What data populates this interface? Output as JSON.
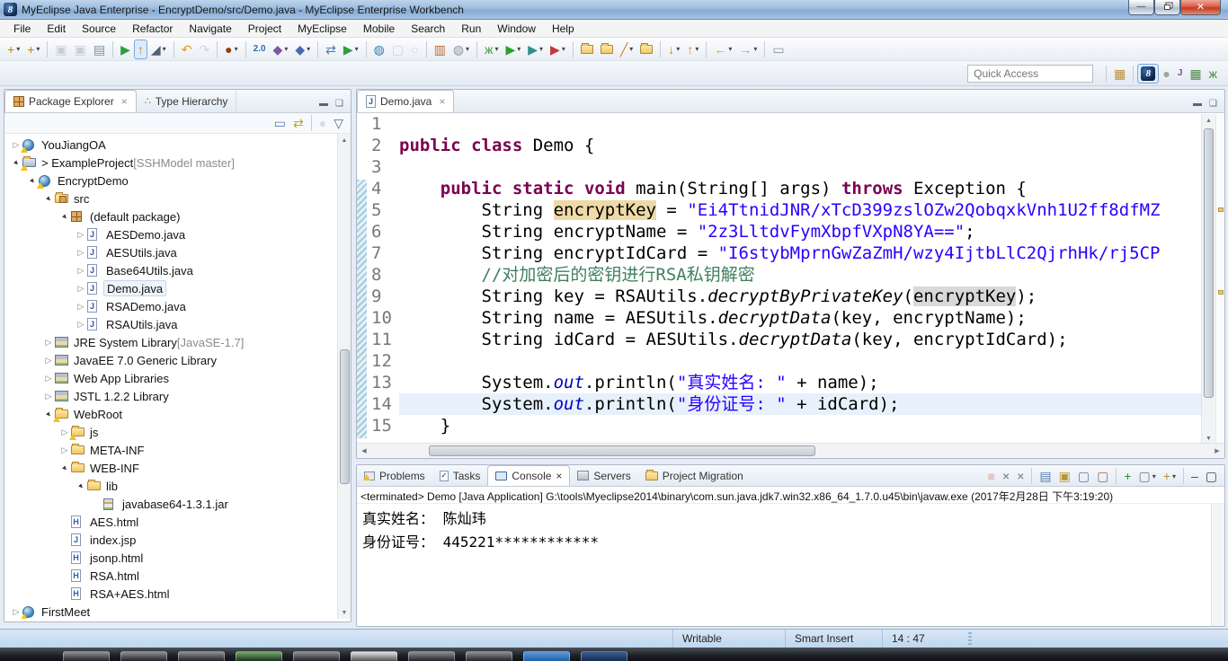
{
  "window": {
    "title": "MyEclipse Java Enterprise - EncryptDemo/src/Demo.java - MyEclipse Enterprise Workbench",
    "controls": {
      "minimize": "minimize",
      "restore": "restore",
      "close": "close"
    }
  },
  "menu_bar": [
    "File",
    "Edit",
    "Source",
    "Refactor",
    "Navigate",
    "Project",
    "MyEclipse",
    "Mobile",
    "Search",
    "Run",
    "Window",
    "Help"
  ],
  "toolbar": {
    "quick_access": "Quick Access",
    "row1": [
      {
        "n": "new-wizard-button",
        "g": "+",
        "c": "#b8860b",
        "dd": 1
      },
      {
        "n": "new-web-project-button",
        "g": "+",
        "c": "#b8860b",
        "dd": 1
      },
      "|",
      {
        "n": "save-button",
        "g": "▣",
        "c": "#8a94a0",
        "dis": 1
      },
      {
        "n": "save-all-button",
        "g": "▣",
        "c": "#8a94a0",
        "dis": 1
      },
      {
        "n": "print-button",
        "g": "▤",
        "c": "#7d8ea4"
      },
      "|",
      {
        "n": "run-mobile-tools-button",
        "g": "▶",
        "c": "#2e9e3e"
      },
      {
        "n": "deploy-project-button",
        "g": "↑",
        "c": "#c08030",
        "sel": 1
      },
      {
        "n": "build-hammer-button",
        "g": "◢",
        "c": "#55606e",
        "dd": 1
      },
      "|",
      {
        "n": "undo-button",
        "g": "↶",
        "c": "#d4a017"
      },
      {
        "n": "redo-button",
        "g": "↷",
        "c": "#9aa4b0",
        "dis": 1
      },
      "|",
      {
        "n": "new-java-ee-button",
        "g": "●",
        "c": "#8b4513",
        "dd": 1
      },
      "|",
      {
        "n": "web-20-browser-button",
        "g": "2.0",
        "c": "#2e6db5",
        "small": 1
      },
      {
        "n": "new-class-wizard-button",
        "g": "◆",
        "c": "#7a5aa0",
        "dd": 1
      },
      {
        "n": "new-interface-wizard-button",
        "g": "◆",
        "c": "#4a6ab0",
        "dd": 1
      },
      "|",
      {
        "n": "sync-deploy-button",
        "g": "⇄",
        "c": "#4a7ab5"
      },
      {
        "n": "run-server-button",
        "g": "▶",
        "c": "#2e9e3e",
        "dd": 1
      },
      "|",
      {
        "n": "web-browser-button",
        "g": "◍",
        "c": "#2e7db5"
      },
      {
        "n": "capture-button",
        "g": "▢",
        "c": "#9aa4b0",
        "dis": 1
      },
      {
        "n": "history-button",
        "g": "○",
        "c": "#9aa4b0",
        "dis": 1
      },
      "|",
      {
        "n": "report-design-button",
        "g": "▥",
        "c": "#c06a2a"
      },
      {
        "n": "browser-profile-button",
        "g": "◍",
        "c": "#8a94a0",
        "dd": 1
      },
      "|",
      {
        "n": "debug-button",
        "g": "ж",
        "c": "#3f9e3f",
        "dd": 1
      },
      {
        "n": "run-button",
        "g": "▶",
        "c": "#2f9e2f",
        "dd": 1
      },
      {
        "n": "run-history-button",
        "g": "▶",
        "c": "#2f8e8e",
        "dd": 1
      },
      {
        "n": "external-tools-button",
        "g": "▶",
        "c": "#c03a3a",
        "dd": 1
      },
      "|",
      {
        "n": "open-resource-button",
        "shape": "folder"
      },
      {
        "n": "open-type-button",
        "shape": "folder"
      },
      {
        "n": "mark-occurrences-button",
        "g": "╱",
        "c": "#d08030",
        "dd": 1
      },
      {
        "n": "search-folder-button",
        "shape": "folder"
      },
      "|",
      {
        "n": "import-button",
        "g": "↓",
        "c": "#c08a20",
        "dd": 1
      },
      {
        "n": "export-button",
        "g": "↑",
        "c": "#c08a20",
        "dd": 1
      },
      "|",
      {
        "n": "back-button",
        "g": "←",
        "c": "#d4a017",
        "dd": 1
      },
      {
        "n": "forward-button",
        "g": "→",
        "c": "#9aa4b0",
        "dd": 1
      },
      "|",
      {
        "n": "last-edit-location-button",
        "g": "▭",
        "c": "#8a94a0"
      }
    ],
    "perspectives": [
      {
        "n": "open-perspective-button",
        "g": "▦",
        "c": "#b8903a",
        "dd": 0
      },
      "|",
      {
        "n": "myeclipse-perspective-button",
        "logo": "8",
        "sel": 1
      },
      {
        "n": "myeclipse-explorer-perspective-button",
        "g": "●",
        "c": "#9aa89a"
      },
      {
        "n": "javaee-perspective-button",
        "g": "J",
        "c": "#7a4a9a",
        "small": 1
      },
      {
        "n": "resource-perspective-button",
        "g": "▦",
        "c": "#4a8a4a"
      },
      {
        "n": "debug-perspective-button",
        "g": "ж",
        "c": "#3f8e3f"
      }
    ]
  },
  "package_explorer": {
    "tabs": [
      {
        "label": "Package Explorer",
        "active": true,
        "closable": true,
        "icon": "pkg"
      },
      {
        "label": "Type Hierarchy",
        "active": false,
        "icon": "hier"
      }
    ],
    "local_toolbar": [
      {
        "n": "collapse-all-button",
        "g": "▭",
        "c": "#5a7ab0"
      },
      {
        "n": "link-with-editor-button",
        "g": "⇄",
        "c": "#c8a020"
      },
      "|",
      {
        "n": "focus-button",
        "g": "●",
        "c": "#aab4be",
        "dis": 1
      },
      {
        "n": "view-menu-button",
        "g": "▽",
        "c": "#5a6676"
      }
    ],
    "tree": [
      {
        "d": 0,
        "x": "c",
        "icon": "web",
        "warn": 1,
        "label": "YouJiangOA"
      },
      {
        "d": 0,
        "x": "e",
        "icon": "javaproj",
        "warn": 1,
        "label": "> ExampleProject",
        "deco": " [SSHModel master]"
      },
      {
        "d": 1,
        "x": "e",
        "icon": "web",
        "warn": 1,
        "label": "EncryptDemo"
      },
      {
        "d": 2,
        "x": "e",
        "icon": "srcfolder",
        "label": "src"
      },
      {
        "d": 3,
        "x": "e",
        "icon": "package",
        "label": "(default package)"
      },
      {
        "d": 4,
        "x": "c",
        "icon": "jfile",
        "label": "AESDemo.java"
      },
      {
        "d": 4,
        "x": "c",
        "icon": "jfile",
        "label": "AESUtils.java"
      },
      {
        "d": 4,
        "x": "c",
        "icon": "jfile",
        "label": "Base64Utils.java"
      },
      {
        "d": 4,
        "x": "c",
        "icon": "jfile",
        "label": "Demo.java",
        "selected": 1
      },
      {
        "d": 4,
        "x": "c",
        "icon": "jfile",
        "label": "RSADemo.java"
      },
      {
        "d": 4,
        "x": "c",
        "icon": "jfile",
        "label": "RSAUtils.java"
      },
      {
        "d": 2,
        "x": "c",
        "icon": "lib",
        "label": "JRE System Library",
        "deco": " [JavaSE-1.7]"
      },
      {
        "d": 2,
        "x": "c",
        "icon": "lib",
        "label": "JavaEE 7.0 Generic Library"
      },
      {
        "d": 2,
        "x": "c",
        "icon": "lib",
        "label": "Web App Libraries"
      },
      {
        "d": 2,
        "x": "c",
        "icon": "lib",
        "label": "JSTL 1.2.2 Library"
      },
      {
        "d": 2,
        "x": "e",
        "icon": "folder",
        "warn": 1,
        "label": "WebRoot"
      },
      {
        "d": 3,
        "x": "c",
        "icon": "folder",
        "warn": 1,
        "label": "js"
      },
      {
        "d": 3,
        "x": "c",
        "icon": "folder",
        "label": "META-INF"
      },
      {
        "d": 3,
        "x": "e",
        "icon": "folder",
        "label": "WEB-INF"
      },
      {
        "d": 4,
        "x": "e",
        "icon": "folder",
        "label": "lib"
      },
      {
        "d": 5,
        "x": "n",
        "icon": "jar",
        "label": "javabase64-1.3.1.jar"
      },
      {
        "d": 3,
        "x": "n",
        "icon": "html",
        "label": "AES.html"
      },
      {
        "d": 3,
        "x": "n",
        "icon": "jsp",
        "label": "index.jsp"
      },
      {
        "d": 3,
        "x": "n",
        "icon": "html",
        "label": "jsonp.html"
      },
      {
        "d": 3,
        "x": "n",
        "icon": "html",
        "label": "RSA.html"
      },
      {
        "d": 3,
        "x": "n",
        "icon": "html",
        "label": "RSA+AES.html"
      },
      {
        "d": 0,
        "x": "c",
        "icon": "web",
        "warn": 1,
        "label": "FirstMeet"
      }
    ]
  },
  "editor": {
    "tab_label": "Demo.java",
    "lines": [
      {
        "num": "1",
        "t": []
      },
      {
        "num": "2",
        "t": [
          [
            "k",
            "public"
          ],
          [
            "p",
            " "
          ],
          [
            "k",
            "class"
          ],
          [
            "p",
            " Demo {"
          ]
        ]
      },
      {
        "num": "3",
        "t": []
      },
      {
        "num": "4",
        "t": [
          [
            "p",
            "    "
          ],
          [
            "k",
            "public"
          ],
          [
            "p",
            " "
          ],
          [
            "k",
            "static"
          ],
          [
            "p",
            " "
          ],
          [
            "k",
            "void"
          ],
          [
            "p",
            " main(String[] args) "
          ],
          [
            "k",
            "throws"
          ],
          [
            "p",
            " Exception {"
          ]
        ]
      },
      {
        "num": "5",
        "t": [
          [
            "p",
            "        String "
          ],
          [
            "w",
            "encryptKey"
          ],
          [
            "p",
            " = "
          ],
          [
            "s",
            "\"Ei4TtnidJNR/xTcD399zslOZw2QobqxkVnh1U2ff8dfMZ"
          ]
        ]
      },
      {
        "num": "6",
        "t": [
          [
            "p",
            "        String encryptName = "
          ],
          [
            "s",
            "\"2z3LltdvFymXbpfVXpN8YA==\""
          ],
          [
            "p",
            ";"
          ]
        ]
      },
      {
        "num": "7",
        "t": [
          [
            "p",
            "        String encryptIdCard = "
          ],
          [
            "s",
            "\"I6stybMprnGwZaZmH/wzy4IjtbLlC2QjrhHk/rj5CP"
          ]
        ]
      },
      {
        "num": "8",
        "t": [
          [
            "p",
            "        "
          ],
          [
            "c",
            "//对加密后的密钥进行RSA私钥解密"
          ]
        ]
      },
      {
        "num": "9",
        "t": [
          [
            "p",
            "        String key = RSAUtils."
          ],
          [
            "m",
            "decryptByPrivateKey"
          ],
          [
            "p",
            "("
          ],
          [
            "r",
            "encryptKey"
          ],
          [
            "p",
            ");"
          ]
        ]
      },
      {
        "num": "10",
        "t": [
          [
            "p",
            "        String name = AESUtils."
          ],
          [
            "m",
            "decryptData"
          ],
          [
            "p",
            "(key, encryptName);"
          ]
        ]
      },
      {
        "num": "11",
        "t": [
          [
            "p",
            "        String idCard = AESUtils."
          ],
          [
            "m",
            "decryptData"
          ],
          [
            "p",
            "(key, encryptIdCard);"
          ]
        ]
      },
      {
        "num": "12",
        "t": []
      },
      {
        "num": "13",
        "t": [
          [
            "p",
            "        System."
          ],
          [
            "o",
            "out"
          ],
          [
            "p",
            ".println("
          ],
          [
            "s",
            "\"真实姓名: \""
          ],
          [
            "p",
            " + name);"
          ]
        ]
      },
      {
        "num": "14",
        "t": [
          [
            "p",
            "        System."
          ],
          [
            "o",
            "out"
          ],
          [
            "p",
            ".println("
          ],
          [
            "s",
            "\"身份证号: \""
          ],
          [
            "p",
            " + idCard);"
          ],
          [
            "p",
            ""
          ]
        ],
        "current": 1
      },
      {
        "num": "15",
        "t": [
          [
            "p",
            "    }"
          ]
        ]
      }
    ]
  },
  "console": {
    "tabs": [
      {
        "label": "Problems",
        "icon": "problems"
      },
      {
        "label": "Tasks",
        "icon": "tasks"
      },
      {
        "label": "Console",
        "icon": "console",
        "active": true,
        "closable": true
      },
      {
        "label": "Servers",
        "icon": "servers"
      },
      {
        "label": "Project Migration",
        "icon": "migration"
      }
    ],
    "toolbar": [
      {
        "n": "terminate-button",
        "g": "■",
        "c": "#d88a80",
        "dis": 1
      },
      {
        "n": "remove-launch-button",
        "g": "×",
        "c": "#6a7482"
      },
      {
        "n": "remove-all-launches-button",
        "g": "×",
        "c": "#6a7482"
      },
      "|",
      {
        "n": "clear-console-button",
        "g": "▤",
        "c": "#5a7ab0"
      },
      {
        "n": "scroll-lock-button",
        "g": "▣",
        "c": "#b8963a"
      },
      {
        "n": "show-stdout-button",
        "g": "▢",
        "c": "#5a7ab0"
      },
      {
        "n": "show-stderr-button",
        "g": "▢",
        "c": "#b05a5a"
      },
      "|",
      {
        "n": "pin-console-button",
        "g": "+",
        "c": "#3a8a3a"
      },
      {
        "n": "display-console-button",
        "g": "▢",
        "c": "#6a7482",
        "dd": 1
      },
      {
        "n": "open-console-button",
        "g": "+",
        "c": "#b8963a",
        "dd": 1
      },
      "|",
      {
        "n": "minimize-view-button",
        "g": "–",
        "c": "#444"
      },
      {
        "n": "maximize-view-button",
        "g": "▢",
        "c": "#444"
      }
    ],
    "header": "<terminated> Demo [Java Application] G:\\tools\\Myeclipse2014\\binary\\com.sun.java.jdk7.win32.x86_64_1.7.0.u45\\bin\\javaw.exe (2017年2月28日 下午3:19:20)",
    "output": [
      "真实姓名： 陈灿玮",
      "身份证号： 445221************"
    ]
  },
  "status_bar": {
    "writable": "Writable",
    "insert_mode": "Smart Insert",
    "cursor_position": "14 : 47"
  },
  "taskbar": {
    "buttons": [
      "glass",
      "glass",
      "glass",
      "green",
      "glass",
      "white",
      "glass",
      "glass",
      "blue",
      "navy"
    ]
  }
}
